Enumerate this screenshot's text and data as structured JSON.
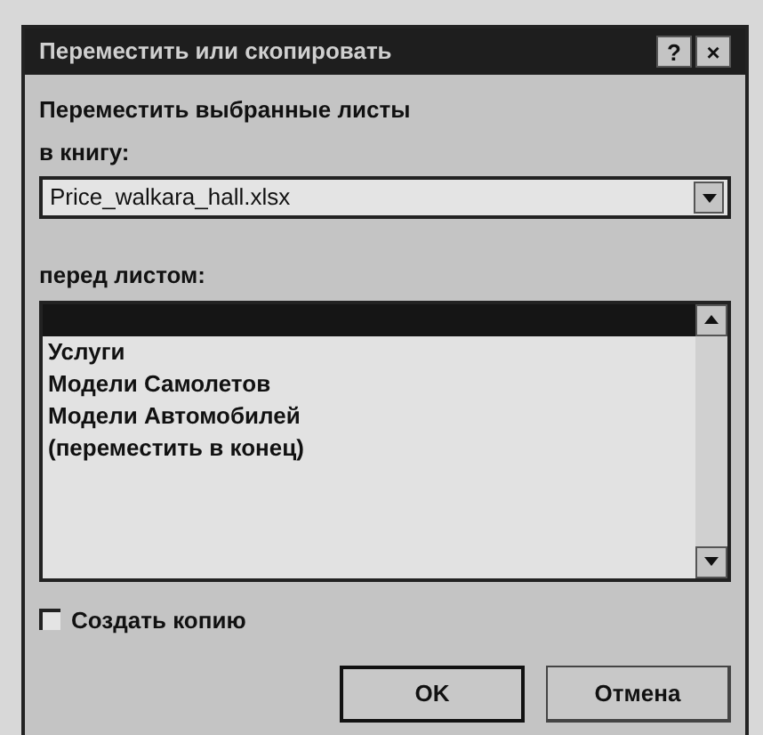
{
  "window": {
    "title": "Переместить или скопировать",
    "buttons": [
      "?",
      "×"
    ]
  },
  "move_label": "Переместить выбранные листы",
  "book_label": "в книгу:",
  "book_select": {
    "value": "Price_walkara_hall.xlsx"
  },
  "before_label": "перед листом:",
  "sheets": [
    {
      "selected": true
    },
    {
      "label": "Услуги",
      "selected": false
    },
    {
      "label": "Модели Самолетов",
      "selected": false
    },
    {
      "label": "Модели Автомобилей",
      "selected": false
    },
    {
      "label": "(переместить в конец)",
      "selected": false
    }
  ],
  "copy_checkbox": {
    "label": "Создать копию",
    "checked": false
  },
  "buttons": [
    {
      "label": "OK",
      "default": true
    },
    {
      "label": "Отмена",
      "default": false
    }
  ]
}
